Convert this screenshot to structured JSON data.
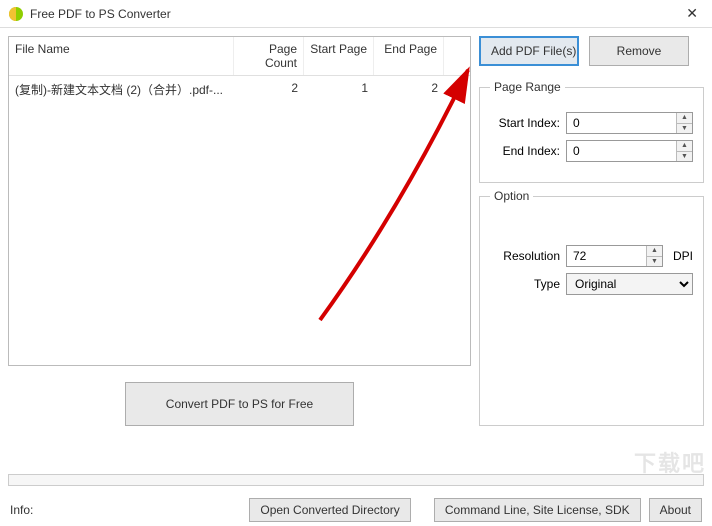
{
  "window": {
    "title": "Free PDF to PS Converter"
  },
  "table": {
    "headers": {
      "file_name": "File Name",
      "page_count": "Page Count",
      "start_page": "Start Page",
      "end_page": "End Page"
    },
    "rows": [
      {
        "file_name": "(复制)-新建文本文档 (2)（合并）.pdf-...",
        "page_count": "2",
        "start_page": "1",
        "end_page": "2"
      }
    ]
  },
  "buttons": {
    "add": "Add PDF File(s)",
    "remove": "Remove",
    "convert": "Convert PDF to PS for Free",
    "open_dir": "Open Converted Directory",
    "cmdline": "Command Line, Site License, SDK",
    "about": "About"
  },
  "page_range": {
    "legend": "Page Range",
    "start_label": "Start Index:",
    "start_value": "0",
    "end_label": "End Index:",
    "end_value": "0"
  },
  "option": {
    "legend": "Option",
    "resolution_label": "Resolution",
    "resolution_value": "72",
    "dpi": "DPI",
    "type_label": "Type",
    "type_value": "Original"
  },
  "info_label": "Info:",
  "watermark": "下载吧"
}
